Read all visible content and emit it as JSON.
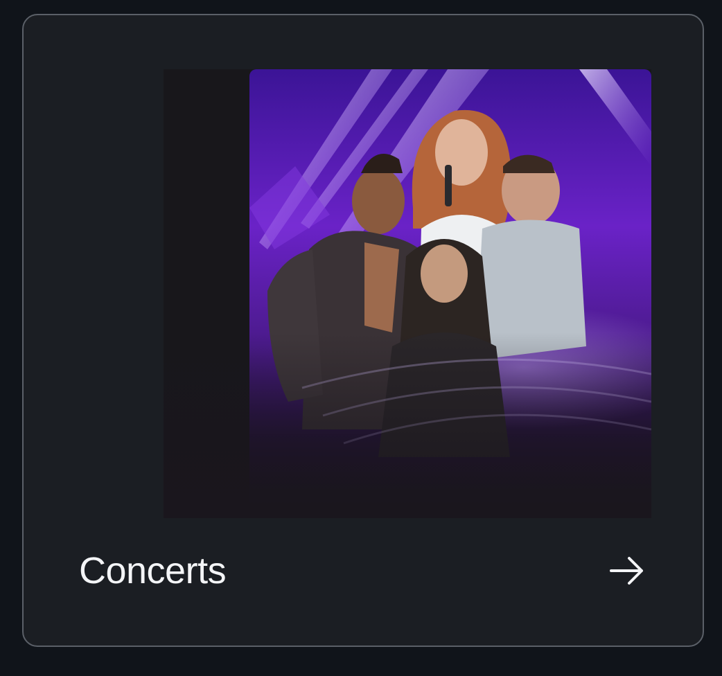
{
  "card": {
    "title": "Concerts",
    "arrow_icon": "arrow-right-icon",
    "image_icon": "concert-artwork-image"
  },
  "colors": {
    "page_background": "#10141a",
    "card_background": "#1b1e23",
    "card_border": "#5b6068",
    "accent_purple": "#7a2fd6",
    "text": "#f4f5f7"
  }
}
